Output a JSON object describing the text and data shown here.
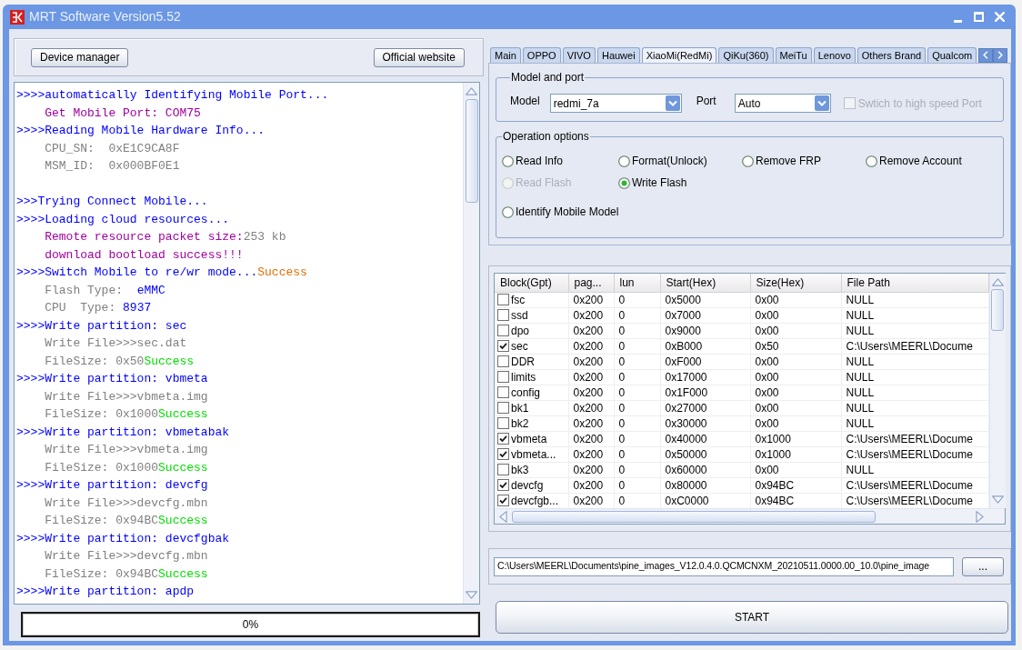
{
  "window": {
    "title": "MRT Software Version5.52"
  },
  "top_buttons": [
    "Device manager",
    "Official website"
  ],
  "log": {
    "blocks": [
      {
        "lines": [
          {
            "kind": "step",
            "segments": [
              {
                "text": ">>>>automatically Identifying Mobile Port...",
                "color": "#0000ff"
              }
            ]
          },
          {
            "kind": "detail",
            "segments": [
              {
                "text": "Get Mobile Port: COM75",
                "color": "#a000a0"
              }
            ]
          },
          {
            "kind": "step",
            "segments": [
              {
                "text": ">>>>Reading Mobile Hardware Info...",
                "color": "#0000ff"
              }
            ]
          },
          {
            "kind": "detail",
            "segments": [
              {
                "text": "CPU_SN:  0xE1C9CA8F",
                "color": "#808080"
              }
            ]
          },
          {
            "kind": "detail",
            "segments": [
              {
                "text": "MSM_ID:  0x000BF0E1",
                "color": "#808080"
              }
            ]
          }
        ]
      },
      {
        "lines": [
          {
            "kind": "step",
            "segments": [
              {
                "text": ">>>Trying Connect Mobile...",
                "color": "#0000ff"
              }
            ]
          },
          {
            "kind": "step",
            "segments": [
              {
                "text": ">>>>Loading cloud resources...",
                "color": "#0000ff"
              }
            ]
          },
          {
            "kind": "detail",
            "segments": [
              {
                "text": "Remote resource packet size:",
                "color": "#a000a0"
              },
              {
                "text": "253 kb",
                "color": "#808080"
              }
            ]
          },
          {
            "kind": "detail",
            "segments": [
              {
                "text": "download bootload success!!!",
                "color": "#a000a0"
              }
            ]
          },
          {
            "kind": "step",
            "segments": [
              {
                "text": ">>>>Switch Mobile to re/wr mode...",
                "color": "#0000ff"
              },
              {
                "text": "Success",
                "color": "#e07000"
              }
            ]
          },
          {
            "kind": "detail",
            "segments": [
              {
                "text": "Flash Type:  ",
                "color": "#808080"
              },
              {
                "text": "eMMC",
                "color": "#0000ff"
              }
            ]
          },
          {
            "kind": "detail",
            "segments": [
              {
                "text": "CPU  Type: ",
                "color": "#808080"
              },
              {
                "text": "8937",
                "color": "#0000ff"
              }
            ]
          },
          {
            "kind": "step",
            "segments": [
              {
                "text": ">>>>Write partition: sec",
                "color": "#0000ff"
              }
            ]
          },
          {
            "kind": "detail",
            "segments": [
              {
                "text": "Write File>>>sec.dat",
                "color": "#808080"
              }
            ]
          },
          {
            "kind": "detail",
            "segments": [
              {
                "text": "FileSize: 0x50",
                "color": "#808080"
              },
              {
                "text": "Success",
                "color": "#00dd00"
              }
            ]
          },
          {
            "kind": "step",
            "segments": [
              {
                "text": ">>>>Write partition: vbmeta",
                "color": "#0000ff"
              }
            ]
          },
          {
            "kind": "detail",
            "segments": [
              {
                "text": "Write File>>>vbmeta.img",
                "color": "#808080"
              }
            ]
          },
          {
            "kind": "detail",
            "segments": [
              {
                "text": "FileSize: 0x1000",
                "color": "#808080"
              },
              {
                "text": "Success",
                "color": "#00dd00"
              }
            ]
          },
          {
            "kind": "step",
            "segments": [
              {
                "text": ">>>>Write partition: vbmetabak",
                "color": "#0000ff"
              }
            ]
          },
          {
            "kind": "detail",
            "segments": [
              {
                "text": "Write File>>>vbmeta.img",
                "color": "#808080"
              }
            ]
          },
          {
            "kind": "detail",
            "segments": [
              {
                "text": "FileSize: 0x1000",
                "color": "#808080"
              },
              {
                "text": "Success",
                "color": "#00dd00"
              }
            ]
          },
          {
            "kind": "step",
            "segments": [
              {
                "text": ">>>>Write partition: devcfg",
                "color": "#0000ff"
              }
            ]
          },
          {
            "kind": "detail",
            "segments": [
              {
                "text": "Write File>>>devcfg.mbn",
                "color": "#808080"
              }
            ]
          },
          {
            "kind": "detail",
            "segments": [
              {
                "text": "FileSize: 0x94BC",
                "color": "#808080"
              },
              {
                "text": "Success",
                "color": "#00dd00"
              }
            ]
          },
          {
            "kind": "step",
            "segments": [
              {
                "text": ">>>>Write partition: devcfgbak",
                "color": "#0000ff"
              }
            ]
          },
          {
            "kind": "detail",
            "segments": [
              {
                "text": "Write File>>>devcfg.mbn",
                "color": "#808080"
              }
            ]
          },
          {
            "kind": "detail",
            "segments": [
              {
                "text": "FileSize: 0x94BC",
                "color": "#808080"
              },
              {
                "text": "Success",
                "color": "#00dd00"
              }
            ]
          },
          {
            "kind": "step",
            "segments": [
              {
                "text": ">>>>Write partition: apdp",
                "color": "#0000ff"
              }
            ]
          }
        ]
      }
    ]
  },
  "progress": {
    "level": 0,
    "label": "0%"
  },
  "brand_tabs": [
    {
      "label": "Main",
      "selected": false
    },
    {
      "label": "OPPO",
      "selected": false
    },
    {
      "label": "VIVO",
      "selected": false
    },
    {
      "label": "Hauwei",
      "selected": false
    },
    {
      "label": "XiaoMi(RedMi)",
      "selected": true
    },
    {
      "label": "QiKu(360)",
      "selected": false
    },
    {
      "label": "MeiTu",
      "selected": false
    },
    {
      "label": "Lenovo",
      "selected": false
    },
    {
      "label": "Others Brand",
      "selected": false
    },
    {
      "label": "Qualcom",
      "selected": false
    }
  ],
  "model_and_port": {
    "title": "Model and port",
    "model_label": "Model",
    "model_value": "redmi_7a",
    "port_label": "Port",
    "port_value": "Auto",
    "high_speed": {
      "label": "Swtich to high speed Port",
      "checked": false,
      "disabled": true
    }
  },
  "operation_options": {
    "title": "Operation options",
    "rows": [
      [
        {
          "label": "Read Info",
          "selected": false,
          "disabled": false
        },
        {
          "label": "Format(Unlock)",
          "selected": false,
          "disabled": false
        },
        {
          "label": "Remove FRP",
          "selected": false,
          "disabled": false
        },
        {
          "label": "Remove Account",
          "selected": false,
          "disabled": false
        }
      ],
      [
        {
          "label": "Read Flash",
          "selected": false,
          "disabled": true
        },
        {
          "label": "Write Flash",
          "selected": true,
          "disabled": false
        }
      ],
      [
        {
          "label": "Identify Mobile Model",
          "selected": false,
          "disabled": false
        }
      ]
    ]
  },
  "partition_table": {
    "columns": [
      "Block(Gpt)",
      "pag...",
      "lun",
      "Start(Hex)",
      "Size(Hex)",
      "File Path"
    ],
    "rows": [
      {
        "checked": false,
        "cells": [
          "fsc",
          "0x200",
          "0",
          "0x5000",
          "0x00",
          "NULL"
        ]
      },
      {
        "checked": false,
        "cells": [
          "ssd",
          "0x200",
          "0",
          "0x7000",
          "0x00",
          "NULL"
        ]
      },
      {
        "checked": false,
        "cells": [
          "dpo",
          "0x200",
          "0",
          "0x9000",
          "0x00",
          "NULL"
        ]
      },
      {
        "checked": true,
        "cells": [
          "sec",
          "0x200",
          "0",
          "0xB000",
          "0x50",
          "C:\\Users\\MEERL\\Docume"
        ]
      },
      {
        "checked": false,
        "cells": [
          "DDR",
          "0x200",
          "0",
          "0xF000",
          "0x00",
          "NULL"
        ]
      },
      {
        "checked": false,
        "cells": [
          "limits",
          "0x200",
          "0",
          "0x17000",
          "0x00",
          "NULL"
        ]
      },
      {
        "checked": false,
        "cells": [
          "config",
          "0x200",
          "0",
          "0x1F000",
          "0x00",
          "NULL"
        ]
      },
      {
        "checked": false,
        "cells": [
          "bk1",
          "0x200",
          "0",
          "0x27000",
          "0x00",
          "NULL"
        ]
      },
      {
        "checked": false,
        "cells": [
          "bk2",
          "0x200",
          "0",
          "0x30000",
          "0x00",
          "NULL"
        ]
      },
      {
        "checked": true,
        "cells": [
          "vbmeta",
          "0x200",
          "0",
          "0x40000",
          "0x1000",
          "C:\\Users\\MEERL\\Docume"
        ]
      },
      {
        "checked": true,
        "cells": [
          "vbmeta...",
          "0x200",
          "0",
          "0x50000",
          "0x1000",
          "C:\\Users\\MEERL\\Docume"
        ]
      },
      {
        "checked": false,
        "cells": [
          "bk3",
          "0x200",
          "0",
          "0x60000",
          "0x00",
          "NULL"
        ]
      },
      {
        "checked": true,
        "cells": [
          "devcfg",
          "0x200",
          "0",
          "0x80000",
          "0x94BC",
          "C:\\Users\\MEERL\\Docume"
        ]
      },
      {
        "checked": true,
        "cells": [
          "devcfgb...",
          "0x200",
          "0",
          "0xC0000",
          "0x94BC",
          "C:\\Users\\MEERL\\Docume"
        ]
      }
    ]
  },
  "file_path": {
    "value": "C:\\Users\\MEERL\\Documents\\pine_images_V12.0.4.0.QCMCNXM_20210511.0000.00_10.0\\pine_image",
    "browse_button": "..."
  },
  "start_button": "START"
}
